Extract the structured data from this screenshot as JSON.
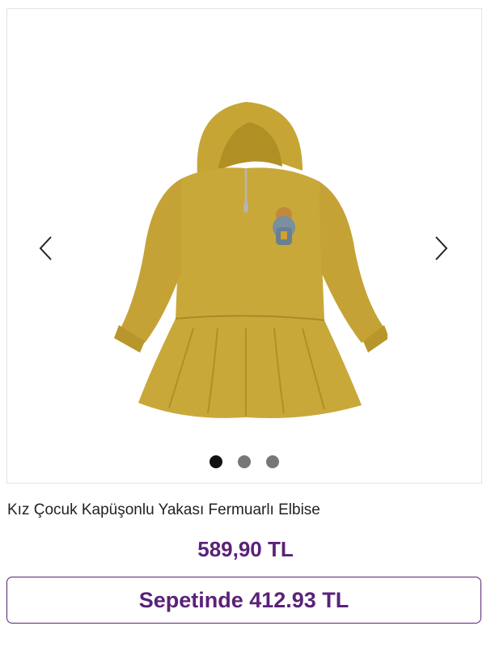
{
  "product": {
    "title": "Kız Çocuk Kapüşonlu Yakası Fermuarlı Elbise",
    "price": "589,90 TL",
    "basket_price": "Sepetinde 412.93 TL"
  },
  "carousel": {
    "prev_icon": "chevron-left-icon",
    "next_icon": "chevron-right-icon",
    "slide_count": 3,
    "active_slide": 1,
    "image_description_icon": "product-image"
  },
  "colors": {
    "accent": "#5a2278",
    "dress": "#c9a83a",
    "dot_active": "#111111",
    "dot_inactive": "#777777"
  }
}
